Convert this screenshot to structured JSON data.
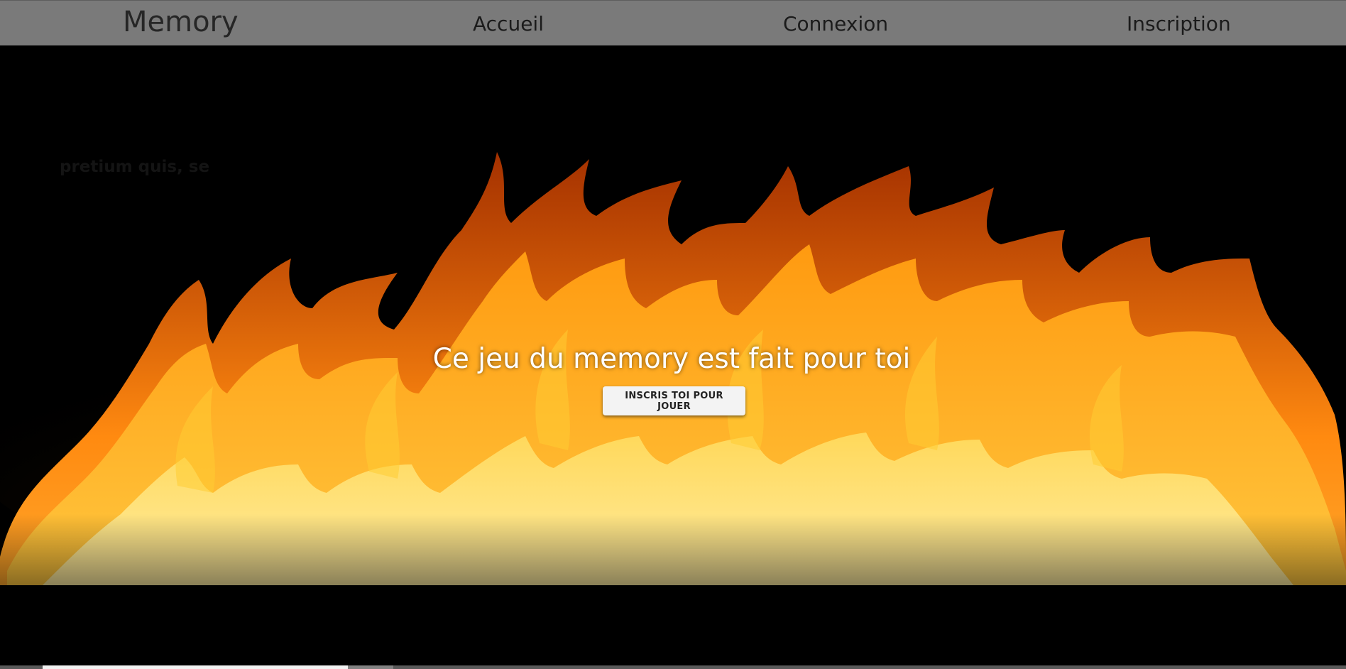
{
  "nav": {
    "brand": "Memory",
    "links": [
      {
        "label": "Accueil"
      },
      {
        "label": "Connexion"
      },
      {
        "label": "Inscription"
      }
    ]
  },
  "hero": {
    "faint_text": "pretium quis, se",
    "title": "Ce jeu du memory est fait pour toi",
    "cta_label": "INSCRIS TOI POUR JOUER",
    "background_image": "flames-on-black"
  },
  "colors": {
    "nav_bg": "#7a7a7a",
    "nav_text": "#1b1b1b",
    "hero_bg": "#000000",
    "button_bg": "#f3f3f3",
    "flame_core": "#fff6b0",
    "flame_mid": "#ffb21c",
    "flame_outer": "#d84a00"
  }
}
